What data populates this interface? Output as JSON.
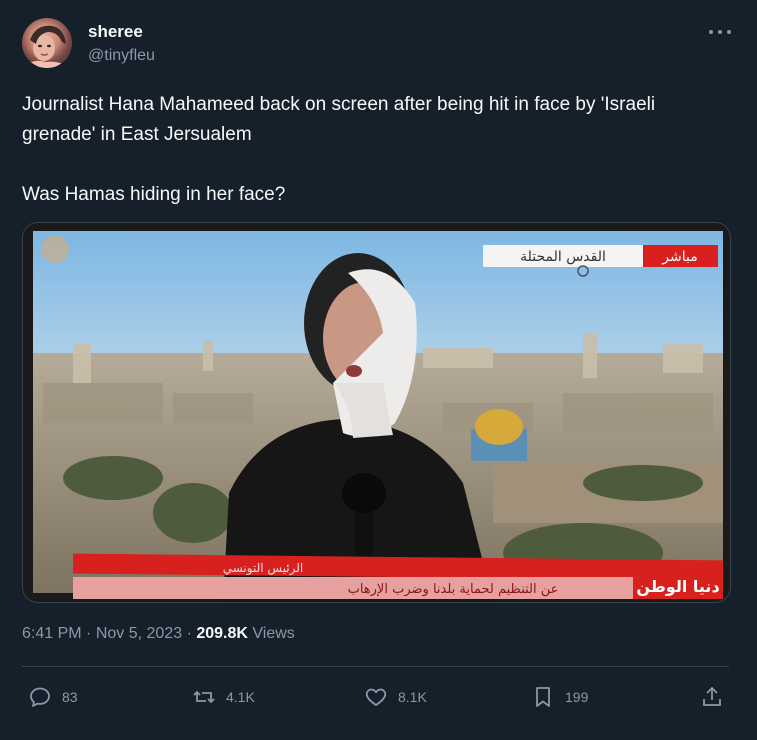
{
  "author": {
    "display_name": "sheree",
    "handle": "@tinyfleu"
  },
  "tweet": {
    "line1": "Journalist Hana Mahameed back on screen after being hit in face by 'Israeli grenade' in East Jersualem",
    "line2": "Was Hamas hiding in her face?"
  },
  "media": {
    "live_badge": "مباشر",
    "location_text": "القدس المحتلة",
    "channel_logo": "دنيا الوطن",
    "ticker_text": "عن التنظيم لحماية بلدنا وضرب الإرهاب",
    "ticker_text_2": "الرئيس التونسي"
  },
  "meta": {
    "time": "6:41 PM",
    "separator": "·",
    "date": "Nov 5, 2023",
    "views_count": "209.8K",
    "views_label": "Views"
  },
  "actions": {
    "replies": "83",
    "retweets": "4.1K",
    "likes": "8.1K",
    "bookmarks": "199"
  },
  "colors": {
    "background": "#15202b",
    "text": "#f7f9f9",
    "secondary": "#8b98a5",
    "border": "#38444d",
    "ticker_red": "#d8211f"
  }
}
